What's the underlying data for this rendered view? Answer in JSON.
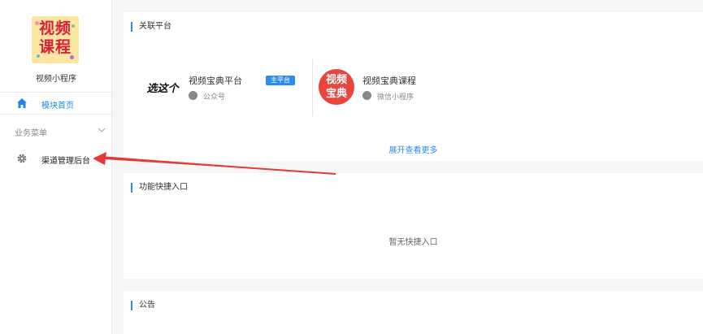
{
  "sidebar": {
    "app_logo_text": "视频课程",
    "app_name": "视频小程序",
    "home_label": "模块首页",
    "group_label": "业务菜单",
    "menu_item_label": "渠道管理后台"
  },
  "main": {
    "linked_section": {
      "title": "关联平台",
      "platforms": [
        {
          "name": "视频宝典平台",
          "badge": "主平台",
          "type": "公众号",
          "logo_text": "选这个"
        },
        {
          "name": "视频宝典课程",
          "type": "微信小程序",
          "logo_text": "视频宝典"
        }
      ],
      "expand_label": "展开查看更多"
    },
    "shortcut_section": {
      "title": "功能快捷入口",
      "empty_text": "暂无快捷入口"
    },
    "notice_section": {
      "title": "公告"
    }
  },
  "colors": {
    "accent": "#2d8cf0",
    "annotation_arrow": "#e53935"
  }
}
